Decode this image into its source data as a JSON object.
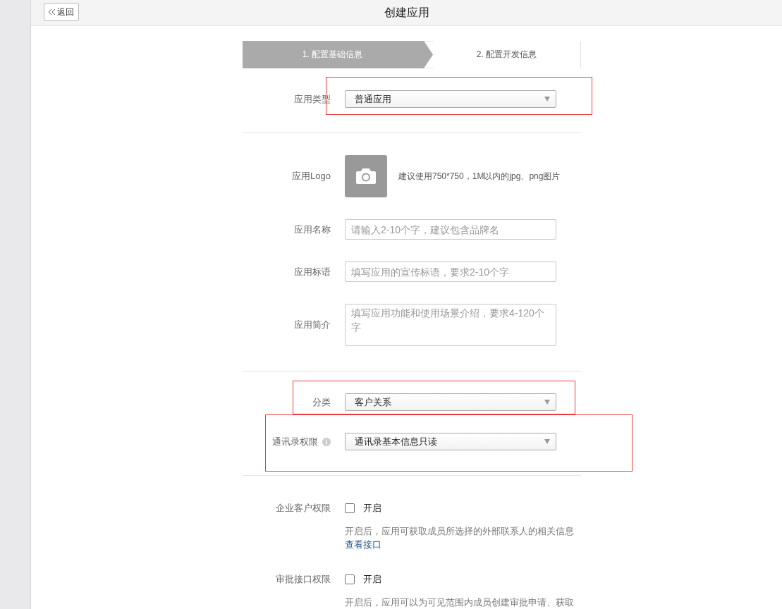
{
  "back_button": "返回",
  "title": "创建应用",
  "steps": [
    {
      "label": "1. 配置基础信息",
      "selected": true
    },
    {
      "label": "2. 配置开发信息",
      "selected": false
    }
  ],
  "sections": [
    {
      "fields": [
        {
          "kind": "select",
          "label": "应用类型",
          "value": "普通应用",
          "highlighted": true
        }
      ]
    },
    {
      "fields": [
        {
          "kind": "logo",
          "label": "应用Logo",
          "hint": "建议使用750*750，1M以内的jpg、png图片"
        },
        {
          "kind": "input",
          "label": "应用名称",
          "placeholder": "请输入2-10个字，建议包含品牌名"
        },
        {
          "kind": "input",
          "label": "应用标语",
          "placeholder": "填写应用的宣传标语，要求2-10个字"
        },
        {
          "kind": "textarea",
          "label": "应用简介",
          "placeholder": "填写应用功能和使用场景介绍，要求4-120个字"
        }
      ]
    },
    {
      "fields": [
        {
          "kind": "select",
          "label": "分类",
          "value": "客户关系",
          "highlighted": true
        },
        {
          "kind": "select",
          "label": "通讯录权限",
          "value": "通讯录基本信息只读",
          "info": true,
          "highlighted": true
        }
      ]
    },
    {
      "fields": [
        {
          "kind": "checkbox",
          "label": "企业客户权限",
          "option": "开启",
          "checked": false,
          "description": "开启后，应用可获取成员所选择的外部联系人的相关信息",
          "link": "查看接口"
        },
        {
          "kind": "checkbox",
          "label": "审批接口权限",
          "option": "开启",
          "checked": false,
          "description": "开启后，应用可以为可见范围内成员创建审批申请、获取"
        }
      ]
    }
  ]
}
